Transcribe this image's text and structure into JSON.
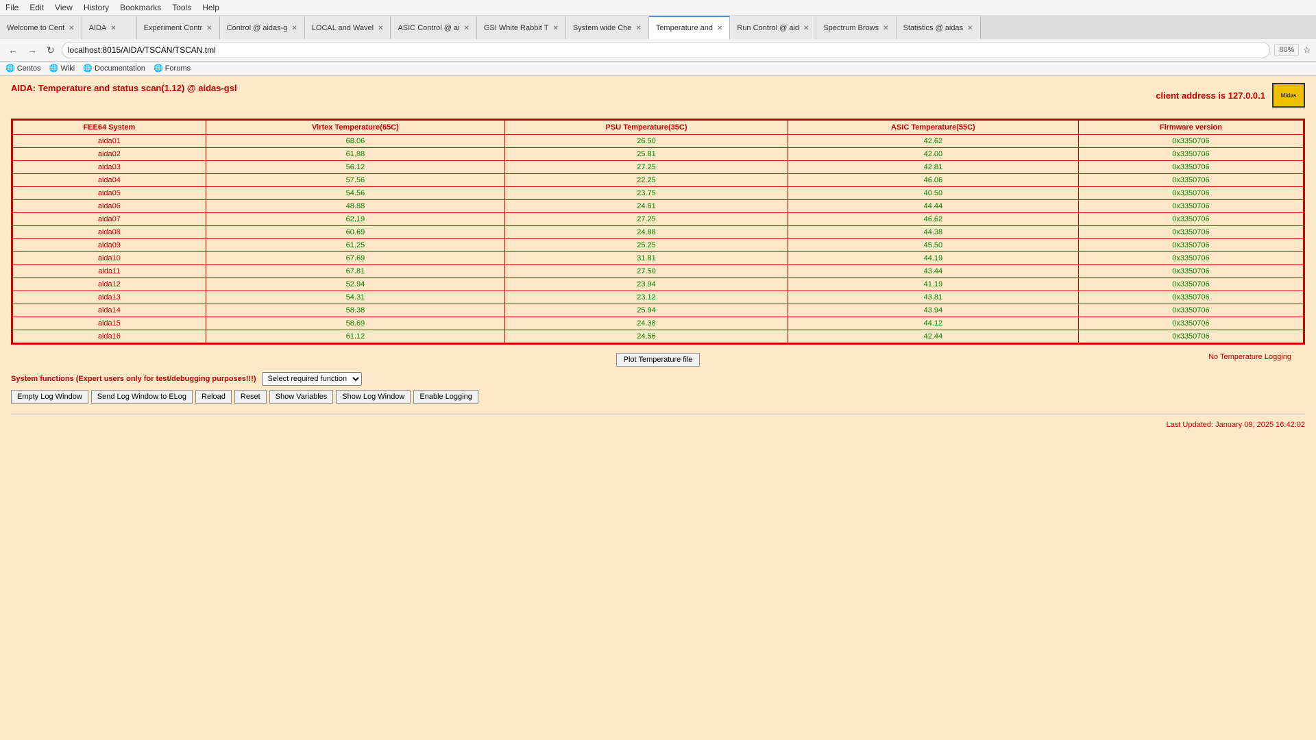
{
  "browser": {
    "tabs": [
      {
        "label": "Welcome to Cent",
        "active": false,
        "closable": true
      },
      {
        "label": "AIDA",
        "active": false,
        "closable": true
      },
      {
        "label": "Experiment Contr",
        "active": false,
        "closable": true
      },
      {
        "label": "Control @ aidas-g",
        "active": false,
        "closable": true
      },
      {
        "label": "LOCAL and Wavel",
        "active": false,
        "closable": true
      },
      {
        "label": "ASIC Control @ ai",
        "active": false,
        "closable": true
      },
      {
        "label": "GSI White Rabbit T",
        "active": false,
        "closable": true
      },
      {
        "label": "System wide Che",
        "active": false,
        "closable": true
      },
      {
        "label": "Temperature and",
        "active": true,
        "closable": true
      },
      {
        "label": "Run Control @ aid",
        "active": false,
        "closable": true
      },
      {
        "label": "Spectrum Brows",
        "active": false,
        "closable": true
      },
      {
        "label": "Statistics @ aidas",
        "active": false,
        "closable": true
      }
    ],
    "url": "localhost:8015/AIDA/TSCAN/TSCAN.tml",
    "zoom": "80%",
    "menu_items": [
      "File",
      "Edit",
      "View",
      "History",
      "Bookmarks",
      "Tools",
      "Help"
    ],
    "bookmarks": [
      "Centos",
      "Wiki",
      "Documentation",
      "Forums"
    ]
  },
  "page": {
    "title": "AIDA: Temperature and status scan(1.12) @ aidas-gsl",
    "client_address_label": "client address is 127.0.0.1",
    "table": {
      "headers": [
        "FEE64 System",
        "Virtex Temperature(65C)",
        "PSU Temperature(35C)",
        "ASIC Temperature(55C)",
        "Firmware version"
      ],
      "rows": [
        [
          "aida01",
          "68.06",
          "26.50",
          "42.62",
          "0x3350706"
        ],
        [
          "aida02",
          "61.88",
          "25.81",
          "42.00",
          "0x3350706"
        ],
        [
          "aida03",
          "56.12",
          "27.25",
          "42.81",
          "0x3350706"
        ],
        [
          "aida04",
          "57.56",
          "22.25",
          "46.06",
          "0x3350706"
        ],
        [
          "aida05",
          "54.56",
          "23.75",
          "40.50",
          "0x3350706"
        ],
        [
          "aida06",
          "48.88",
          "24.81",
          "44.44",
          "0x3350706"
        ],
        [
          "aida07",
          "62.19",
          "27.25",
          "46.62",
          "0x3350706"
        ],
        [
          "aida08",
          "60.69",
          "24.88",
          "44.38",
          "0x3350706"
        ],
        [
          "aida09",
          "61.25",
          "25.25",
          "45.50",
          "0x3350706"
        ],
        [
          "aida10",
          "67.69",
          "31.81",
          "44.19",
          "0x3350706"
        ],
        [
          "aida11",
          "67.81",
          "27.50",
          "43.44",
          "0x3350706"
        ],
        [
          "aida12",
          "52.94",
          "23.94",
          "41.19",
          "0x3350706"
        ],
        [
          "aida13",
          "54.31",
          "23.12",
          "43.81",
          "0x3350706"
        ],
        [
          "aida14",
          "58.38",
          "25.94",
          "43.94",
          "0x3350706"
        ],
        [
          "aida15",
          "58.69",
          "24.38",
          "44.12",
          "0x3350706"
        ],
        [
          "aida16",
          "61.12",
          "24.56",
          "42.44",
          "0x3350706"
        ]
      ]
    },
    "plot_button": "Plot Temperature file",
    "no_logging": "No Temperature Logging",
    "system_functions_label": "System functions (Expert users only for test/debugging purposes!!!)",
    "select_placeholder": "Select required function",
    "buttons": [
      "Empty Log Window",
      "Send Log Window to ELog",
      "Reload",
      "Reset",
      "Show Variables",
      "Show Log Window",
      "Enable Logging"
    ],
    "footer": "Last Updated: January 09, 2025 16:42:02",
    "logo_text": "Midas"
  }
}
